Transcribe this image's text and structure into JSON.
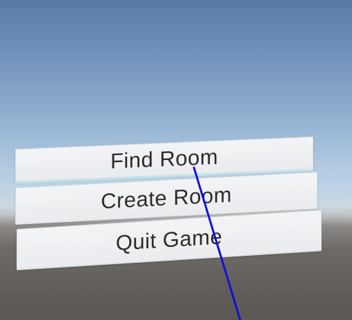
{
  "menu": {
    "find_room_label": "Find Room",
    "create_room_label": "Create Room",
    "quit_game_label": "Quit Game"
  },
  "colors": {
    "sky_top": "#587aa6",
    "sky_horizon": "#c8d7e2",
    "ground": "#615d5a",
    "panel": "#eef0f2",
    "panel_text": "#2c2c2c",
    "pointer_ray": "#1010d8"
  }
}
